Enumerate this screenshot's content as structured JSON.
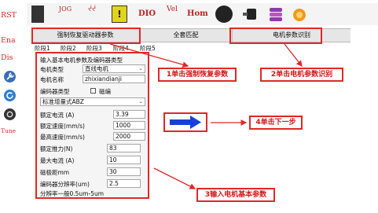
{
  "rail": {
    "items": [
      {
        "label": "RST",
        "kind": "text"
      },
      {
        "label": "Ena",
        "kind": "text"
      },
      {
        "label": "Dis",
        "kind": "text"
      },
      {
        "label": "Tune",
        "kind": "text"
      }
    ],
    "icons": [
      "wrench-icon",
      "refresh-icon",
      "power-icon"
    ]
  },
  "toolbar": {
    "items": [
      {
        "name": "jog-button",
        "label": "JOG"
      },
      {
        "name": "graph-button",
        "label": "ᔫᔫ"
      },
      {
        "name": "warning-button",
        "label": "!"
      },
      {
        "name": "dio-button",
        "label": "DIO"
      },
      {
        "name": "vel-button",
        "label": "Vel"
      },
      {
        "name": "home-button",
        "label": "Hom"
      }
    ]
  },
  "tabs": [
    {
      "label": "强制恢复驱动器参数"
    },
    {
      "label": "全套匹配"
    },
    {
      "label": "电机参数识别"
    }
  ],
  "steps": [
    "阶段1",
    "阶段2",
    "阶段3",
    "阶段4",
    "阶段5"
  ],
  "panel": {
    "title": "输入基本电机参数及编码器类型",
    "motor_type_label": "电机类型",
    "motor_type_value": "直线电机",
    "motor_name_label": "电机名称",
    "motor_name_value": "zhixiandianji",
    "encoder_type_label": "编码器类型",
    "magnetic_label": "磁编",
    "encoder_select_value": "标准增量式ABZ",
    "rows": [
      {
        "label": "额定电流 (A)",
        "value": "3.39"
      },
      {
        "label": "额定速度(mm/s)",
        "value": "1000"
      },
      {
        "label": "最高速度(mm/s)",
        "value": "2000"
      },
      {
        "label": "额定推力(N)",
        "value": "83"
      },
      {
        "label": "最大电流 (A)",
        "value": "10"
      },
      {
        "label": "磁极距mm",
        "value": "30"
      },
      {
        "label": "编码器分辨率(um)",
        "value": "2.5"
      }
    ],
    "hint": "分辨率一般0.5um-5um"
  },
  "annotations": {
    "step1": "1单击强制恢复参数",
    "step2": "2单击电机参数识别",
    "step3": "3输入电机基本参数",
    "step4": "4单击下一步"
  },
  "colors": {
    "annotation_red": "#e02828",
    "next_arrow_blue": "#1a3fd8",
    "rail_text_red": "#d42a2a"
  }
}
